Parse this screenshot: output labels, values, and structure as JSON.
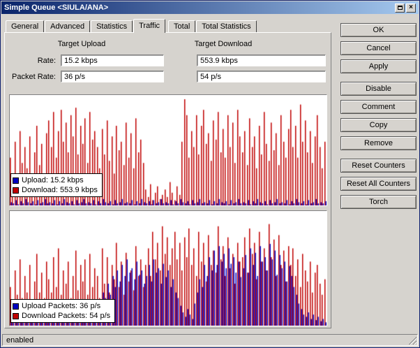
{
  "window": {
    "title": "Simple Queue <SIULA/ANA>",
    "status": "enabled"
  },
  "tabs": [
    {
      "label": "General",
      "active": false
    },
    {
      "label": "Advanced",
      "active": false
    },
    {
      "label": "Statistics",
      "active": false
    },
    {
      "label": "Traffic",
      "active": true
    },
    {
      "label": "Total",
      "active": false
    },
    {
      "label": "Total Statistics",
      "active": false
    }
  ],
  "fields": {
    "target_upload_label": "Target Upload",
    "target_download_label": "Target Download",
    "rate_label": "Rate:",
    "packet_rate_label": "Packet Rate:",
    "rate_upload": "15.2 kbps",
    "rate_download": "553.9 kbps",
    "packet_rate_upload": "36 p/s",
    "packet_rate_download": "54 p/s"
  },
  "buttons": [
    "OK",
    "Cancel",
    "Apply",
    "Disable",
    "Comment",
    "Copy",
    "Remove",
    "Reset Counters",
    "Reset All Counters",
    "Torch"
  ],
  "chart_data": [
    {
      "type": "bar",
      "title": "Traffic rate history (upload/download)",
      "ylim": [
        0,
        100
      ],
      "value_unit": "percent_of_chart_height",
      "grid": false,
      "legend_position": "bottom-left",
      "legend": [
        {
          "color": "#0000c0",
          "label": "Upload: 15.2 kbps"
        },
        {
          "color": "#c00000",
          "label": "Download: 553.9 kbps"
        }
      ],
      "series": [
        {
          "name": "Upload",
          "color": "#0000c0",
          "values": [
            3,
            2,
            5,
            1,
            4,
            2,
            6,
            3,
            2,
            4,
            1,
            5,
            2,
            3,
            6,
            2,
            3,
            2,
            5,
            1,
            4,
            2,
            6,
            3,
            2,
            4,
            1,
            5,
            2,
            3,
            6,
            2,
            3,
            2,
            5,
            1,
            4,
            2,
            6,
            3,
            2,
            4,
            1,
            5,
            2,
            3,
            6,
            2,
            3,
            2,
            5,
            1,
            4,
            2,
            6,
            3,
            2,
            4,
            1,
            5,
            2,
            3,
            6,
            2,
            3,
            2,
            5,
            1,
            4,
            2,
            6,
            3,
            2,
            4,
            1,
            5,
            2,
            3,
            6,
            2,
            3,
            2,
            5,
            1,
            4,
            2,
            6,
            3,
            2,
            4,
            1,
            5,
            2,
            3,
            6,
            2,
            3,
            2,
            5,
            1,
            4,
            2,
            6,
            3,
            2,
            4,
            1,
            5,
            2,
            3,
            6,
            2,
            3,
            2,
            5,
            1,
            4,
            2,
            6,
            3,
            2,
            4,
            1,
            5,
            2,
            3,
            6,
            2,
            3,
            2,
            4
          ]
        },
        {
          "name": "Download",
          "color": "#c00000",
          "values": [
            45,
            30,
            60,
            25,
            70,
            40,
            55,
            35,
            65,
            28,
            50,
            75,
            38,
            58,
            30,
            68,
            80,
            55,
            88,
            45,
            70,
            90,
            60,
            78,
            50,
            85,
            65,
            92,
            48,
            75,
            58,
            82,
            40,
            88,
            62,
            70,
            55,
            35,
            72,
            48,
            80,
            42,
            65,
            30,
            75,
            52,
            60,
            38,
            78,
            45,
            68,
            35,
            82,
            50,
            62,
            40,
            15,
            8,
            20,
            5,
            12,
            18,
            6,
            10,
            15,
            8,
            22,
            12,
            5,
            18,
            10,
            60,
            100,
            85,
            45,
            70,
            55,
            85,
            48,
            75,
            90,
            58,
            68,
            42,
            80,
            62,
            88,
            50,
            72,
            45,
            85,
            55,
            78,
            40,
            90,
            65,
            50,
            70,
            38,
            82,
            55,
            65,
            35,
            75,
            48,
            88,
            58,
            42,
            78,
            52,
            68,
            38,
            85,
            60,
            45,
            72,
            90,
            55,
            75,
            45,
            95,
            60,
            80,
            50,
            70,
            40,
            65,
            85,
            55,
            35,
            60
          ]
        }
      ]
    },
    {
      "type": "bar",
      "title": "Packet rate history (upload/download)",
      "ylim": [
        0,
        100
      ],
      "value_unit": "percent_of_chart_height",
      "grid": false,
      "legend_position": "bottom-left",
      "legend": [
        {
          "color": "#0000c0",
          "label": "Upload Packets: 36 p/s"
        },
        {
          "color": "#c00000",
          "label": "Download Packets: 54 p/s"
        }
      ],
      "series": [
        {
          "name": "Upload Packets",
          "color": "#0000c0",
          "values": [
            5,
            3,
            8,
            4,
            6,
            3,
            7,
            5,
            4,
            8,
            3,
            6,
            4,
            7,
            5,
            3,
            6,
            4,
            8,
            5,
            10,
            4,
            7,
            5,
            9,
            4,
            12,
            6,
            8,
            5,
            10,
            6,
            14,
            8,
            12,
            10,
            15,
            22,
            30,
            25,
            38,
            28,
            45,
            35,
            50,
            40,
            55,
            45,
            60,
            48,
            52,
            42,
            58,
            46,
            50,
            38,
            45,
            55,
            40,
            60,
            48,
            52,
            38,
            56,
            44,
            50,
            35,
            42,
            30,
            25,
            18,
            12,
            8,
            15,
            10,
            6,
            20,
            30,
            42,
            35,
            55,
            45,
            62,
            50,
            68,
            55,
            72,
            58,
            65,
            52,
            70,
            56,
            62,
            48,
            58,
            44,
            52,
            64,
            48,
            70,
            55,
            66,
            45,
            72,
            58,
            62,
            50,
            74,
            60,
            68,
            46,
            64,
            52,
            58,
            40,
            54,
            45,
            35,
            28,
            20,
            15,
            10,
            8,
            12,
            6,
            10,
            5,
            8,
            4,
            6,
            3
          ]
        },
        {
          "name": "Download Packets",
          "color": "#c00000",
          "values": [
            35,
            20,
            50,
            28,
            60,
            25,
            45,
            30,
            55,
            22,
            40,
            65,
            30,
            48,
            25,
            58,
            42,
            30,
            62,
            35,
            70,
            28,
            50,
            38,
            58,
            25,
            45,
            68,
            32,
            55,
            40,
            60,
            28,
            65,
            35,
            52,
            45,
            25,
            70,
            38,
            62,
            30,
            55,
            42,
            75,
            35,
            58,
            28,
            66,
            40,
            50,
            32,
            72,
            45,
            60,
            35,
            55,
            70,
            45,
            85,
            60,
            75,
            50,
            90,
            65,
            80,
            55,
            70,
            85,
            60,
            75,
            50,
            80,
            62,
            88,
            55,
            70,
            45,
            85,
            58,
            75,
            40,
            82,
            55,
            68,
            48,
            90,
            60,
            72,
            45,
            80,
            52,
            65,
            38,
            75,
            58,
            62,
            80,
            48,
            88,
            65,
            75,
            42,
            85,
            58,
            70,
            50,
            92,
            62,
            78,
            45,
            82,
            55,
            68,
            40,
            72,
            55,
            70,
            45,
            60,
            35,
            65,
            50,
            40,
            58,
            30,
            48,
            55,
            38,
            28,
            42
          ]
        }
      ]
    }
  ]
}
